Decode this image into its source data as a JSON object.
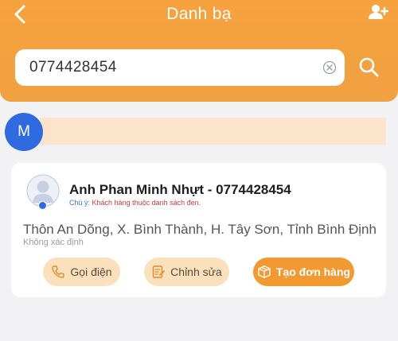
{
  "header": {
    "title": "Danh bạ",
    "back_icon": "chevron-left-icon",
    "add_icon": "add-contact-icon"
  },
  "search": {
    "value": "0774428454",
    "clear_icon": "clear-circle-icon",
    "search_icon": "search-icon"
  },
  "group": {
    "letter": "M",
    "color": "#2f6ae0",
    "strip_color": "#fce3cc"
  },
  "contact": {
    "name_line": "Anh Phan Minh Nhựt - 0774428454",
    "note_label": "Chú ý:",
    "note_text": "Khách hàng thuộc danh sách đen.",
    "address": "Thôn An Dõng, X. Bình Thành, H. Tây Sơn, Tỉnh Bình Định",
    "address_sub": "Không xác định",
    "avatar_icon": "user-avatar-icon"
  },
  "actions": {
    "call_label": "Gọi điện",
    "edit_label": "Chỉnh sửa",
    "order_label": "Tạo đơn hàng"
  },
  "colors": {
    "accent": "#f19a32",
    "header": "#f6a23e",
    "pill": "#fbe0bd",
    "blue": "#2f6ae0",
    "warning": "#d23b3b"
  }
}
